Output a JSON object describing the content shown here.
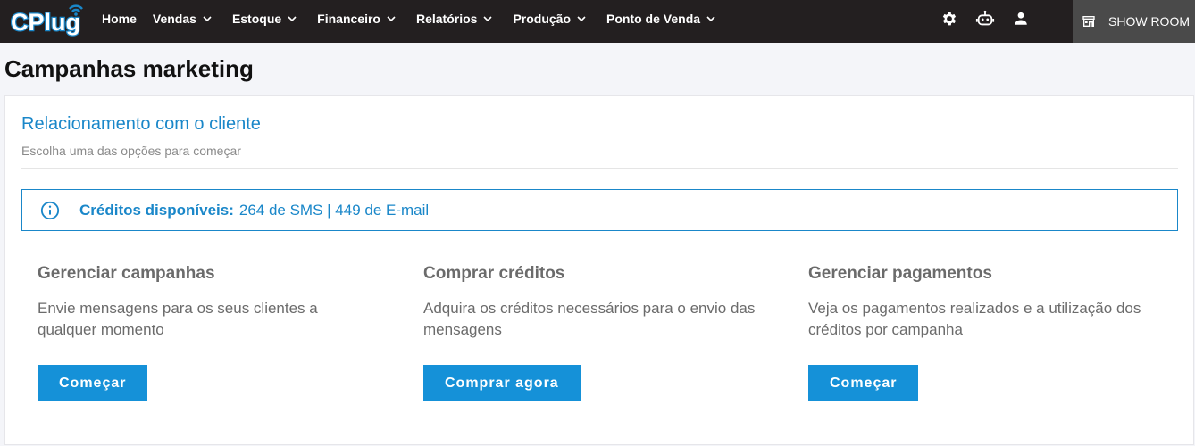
{
  "brand": {
    "logo_text": "CPlug",
    "colors": {
      "topbar": "#231f20",
      "accent": "#1a87c9",
      "button": "#1591d8",
      "showroom_bg": "#4a4a4a"
    }
  },
  "nav": {
    "home": "Home",
    "items": [
      {
        "label": "Vendas"
      },
      {
        "label": "Estoque"
      },
      {
        "label": "Financeiro"
      },
      {
        "label": "Relatórios"
      },
      {
        "label": "Produção"
      },
      {
        "label": "Ponto de Venda"
      }
    ]
  },
  "top_icons": [
    "gear-icon",
    "robot-icon",
    "user-icon"
  ],
  "showroom": {
    "label": "SHOW ROOM",
    "icon": "store-icon"
  },
  "page": {
    "title": "Campanhas marketing"
  },
  "card": {
    "title": "Relacionamento com o cliente",
    "subtitle": "Escolha uma das opções para começar"
  },
  "credits": {
    "icon": "info-icon",
    "label": "Créditos disponíveis:",
    "value": "264 de SMS | 449 de E-mail"
  },
  "options": [
    {
      "title": "Gerenciar campanhas",
      "description": "Envie mensagens para os seus clientes a qualquer momento",
      "button": "Começar"
    },
    {
      "title": "Comprar créditos",
      "description": "Adquira os créditos necessários para o envio das mensagens",
      "button": "Comprar agora"
    },
    {
      "title": "Gerenciar pagamentos",
      "description": "Veja os pagamentos realizados e a utilização dos créditos por campanha",
      "button": "Começar"
    }
  ]
}
